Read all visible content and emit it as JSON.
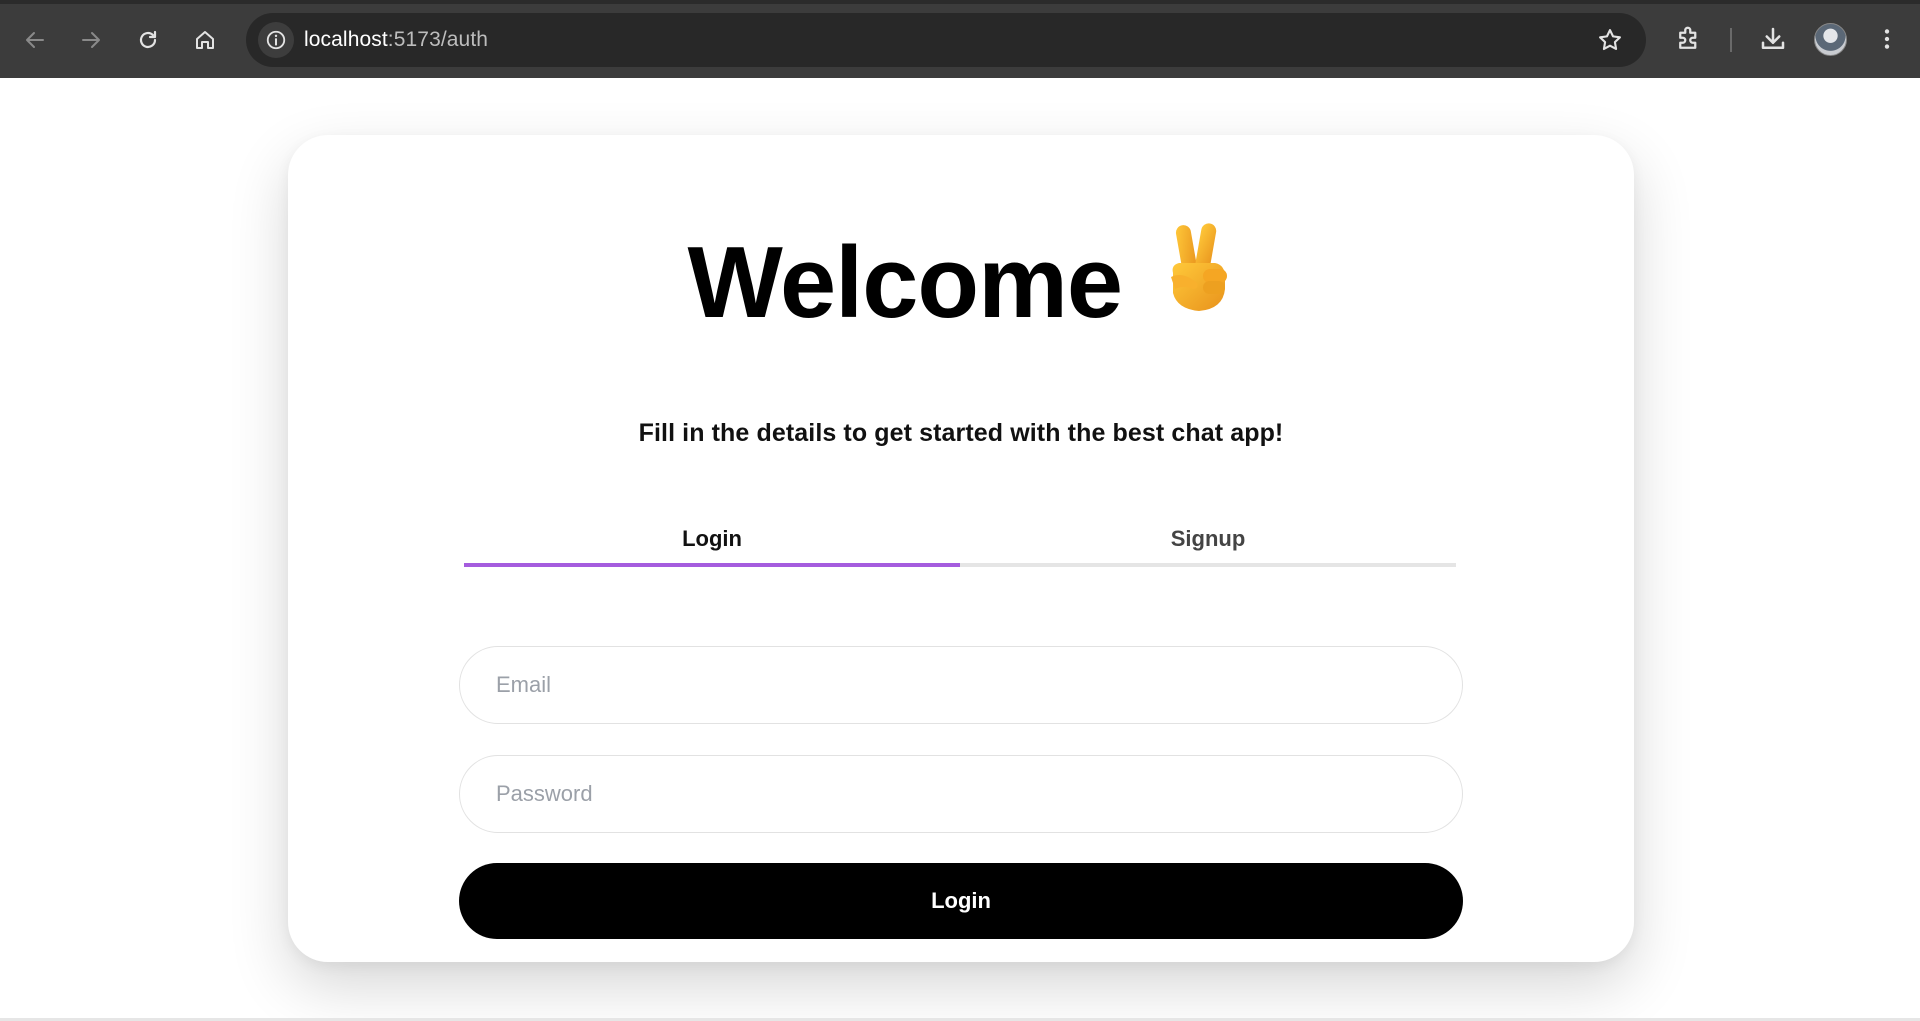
{
  "browser": {
    "url_host": "localhost",
    "url_path": ":5173/auth",
    "icons": [
      "back-icon",
      "forward-icon",
      "reload-icon",
      "home-icon",
      "site-info-icon",
      "bookmark-star-icon",
      "extensions-icon",
      "download-icon",
      "profile-avatar",
      "menu-icon"
    ]
  },
  "auth": {
    "title": "Welcome",
    "title_emoji": "victory-hand",
    "subtitle": "Fill in the details to get started with the best chat app!",
    "tabs": [
      {
        "label": "Login",
        "active": true
      },
      {
        "label": "Signup",
        "active": false
      }
    ],
    "email_placeholder": "Email",
    "password_placeholder": "Password",
    "submit_label": "Login"
  },
  "colors": {
    "tab_active_underline": "#a55cde",
    "button_bg": "#000000",
    "chrome_bg": "#3c3c3c"
  }
}
